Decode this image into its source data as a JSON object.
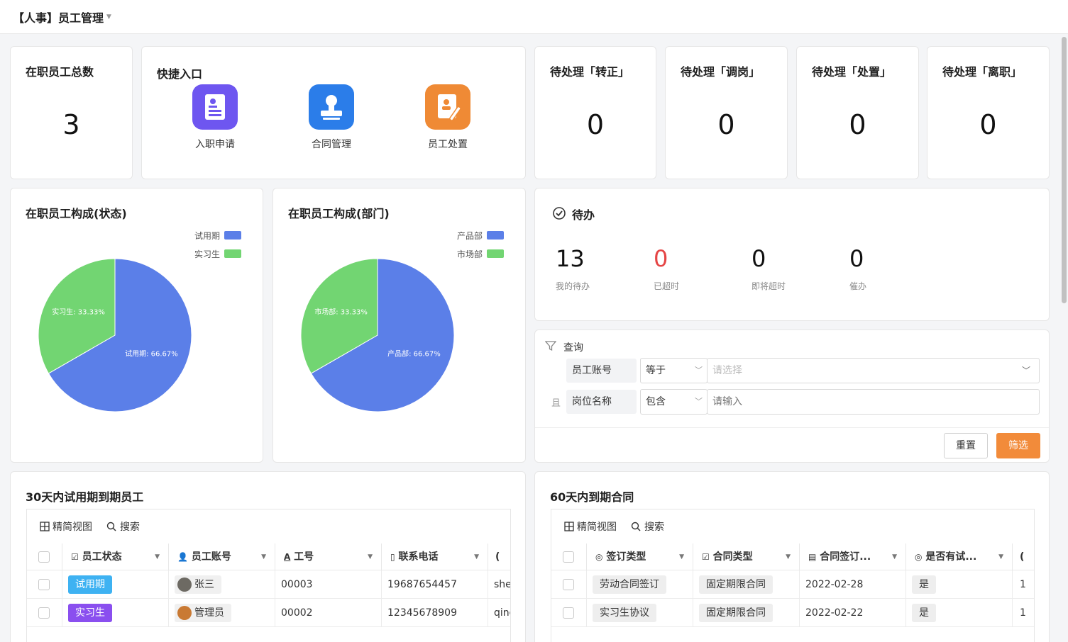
{
  "app": {
    "title": "【人事】员工管理"
  },
  "stats": {
    "total_label": "在职员工总数",
    "total_value": "3",
    "pending": [
      {
        "label": "待处理「转正」",
        "value": "0"
      },
      {
        "label": "待处理「调岗」",
        "value": "0"
      },
      {
        "label": "待处理「处置」",
        "value": "0"
      },
      {
        "label": "待处理「离职」",
        "value": "0"
      }
    ]
  },
  "quick": {
    "title": "快捷入口",
    "items": [
      {
        "label": "入职申请",
        "icon": "onboarding-form-icon",
        "color": "#6e56f0"
      },
      {
        "label": "合同管理",
        "icon": "contract-stamp-icon",
        "color": "#2b7de9"
      },
      {
        "label": "员工处置",
        "icon": "employee-handling-icon",
        "color": "#ef8a35"
      }
    ]
  },
  "pie_status": {
    "title": "在职员工构成(状态)",
    "legend": [
      {
        "name": "试用期",
        "color": "#5b7fe8"
      },
      {
        "name": "实习生",
        "color": "#72d572"
      }
    ],
    "slice_labels": [
      "试用期: 66.67%",
      "实习生: 33.33%"
    ]
  },
  "pie_dept": {
    "title": "在职员工构成(部门)",
    "legend": [
      {
        "name": "产品部",
        "color": "#5b7fe8"
      },
      {
        "name": "市场部",
        "color": "#72d572"
      }
    ],
    "slice_labels": [
      "产品部: 66.67%",
      "市场部: 33.33%"
    ]
  },
  "chart_data": [
    {
      "type": "pie",
      "title": "在职员工构成(状态)",
      "categories": [
        "试用期",
        "实习生"
      ],
      "values": [
        66.67,
        33.33
      ],
      "legend": "top-right"
    },
    {
      "type": "pie",
      "title": "在职员工构成(部门)",
      "categories": [
        "产品部",
        "市场部"
      ],
      "values": [
        66.67,
        33.33
      ],
      "legend": "top-right"
    }
  ],
  "todo": {
    "title": "待办",
    "items": [
      {
        "value": "13",
        "label": "我的待办",
        "color": "#111111"
      },
      {
        "value": "0",
        "label": "已超时",
        "color": "#e54545"
      },
      {
        "value": "0",
        "label": "即将超时",
        "color": "#111111"
      },
      {
        "value": "0",
        "label": "催办",
        "color": "#111111"
      }
    ]
  },
  "query": {
    "title": "查询",
    "conjunction": "且",
    "rows": [
      {
        "field": "员工账号",
        "op": "等于",
        "placeholder": "请选择"
      },
      {
        "field": "岗位名称",
        "op": "包含",
        "placeholder": "请输入"
      }
    ],
    "reset": "重置",
    "filter": "筛选"
  },
  "probation": {
    "title": "30天内试用期到期员工",
    "tool_view": "精简视图",
    "tool_search": "搜索",
    "columns": [
      "员工状态",
      "员工账号",
      "工号",
      "联系电话",
      "("
    ],
    "rows": [
      {
        "status": "试用期",
        "status_color": "#3eb2f2",
        "account": "张三",
        "no": "00003",
        "phone": "19687654457",
        "extra": "she"
      },
      {
        "status": "实习生",
        "status_color": "#8a4fef",
        "account": "管理员",
        "no": "00002",
        "phone": "12345678909",
        "extra": "qing"
      }
    ]
  },
  "contracts": {
    "title": "60天内到期合同",
    "tool_view": "精简视图",
    "tool_search": "搜索",
    "columns": [
      "签订类型",
      "合同类型",
      "合同签订...",
      "是否有试...",
      "("
    ],
    "rows": [
      {
        "sign": "劳动合同签订",
        "type": "固定期限合同",
        "date": "2022-02-28",
        "trial": "是",
        "extra": "1"
      },
      {
        "sign": "实习生协议",
        "type": "固定期限合同",
        "date": "2022-02-22",
        "trial": "是",
        "extra": "1"
      }
    ]
  }
}
